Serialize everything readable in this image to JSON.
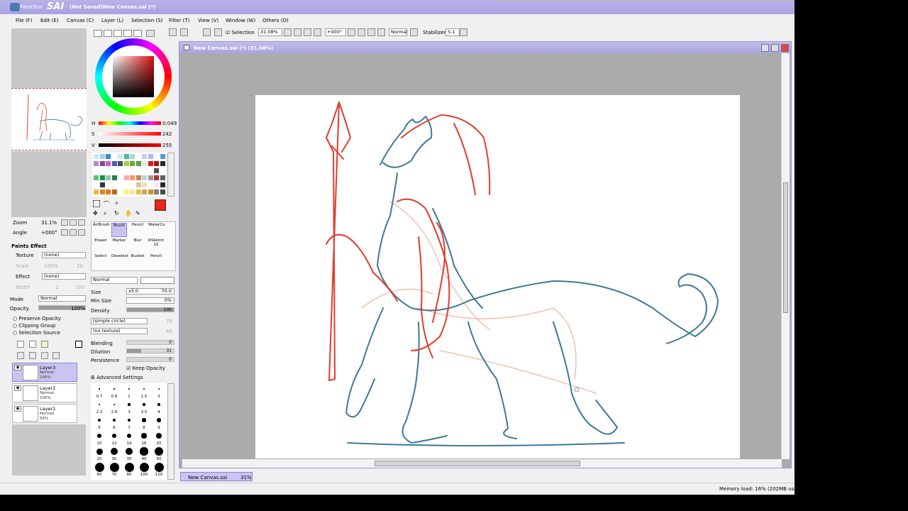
{
  "app": {
    "brand_small": "PaintTool",
    "brand_big": "SAI",
    "title": "(Not Saved)New Canvas.sai (*)"
  },
  "menu": [
    {
      "label": "File (F)"
    },
    {
      "label": "Edit (E)"
    },
    {
      "label": "Canvas (C)"
    },
    {
      "label": "Layer (L)"
    },
    {
      "label": "Selection (S)"
    },
    {
      "label": "Filter (T)"
    },
    {
      "label": "View (V)"
    },
    {
      "label": "Window (W)"
    },
    {
      "label": "Others (O)"
    }
  ],
  "navigator": {
    "zoom_label": "Zoom",
    "zoom_value": "31.1%",
    "angle_label": "Angle",
    "angle_value": "+000°"
  },
  "paints_effect": {
    "header": "Paints Effect",
    "texture_label": "Texture",
    "texture_value": "(none)",
    "scale_label": "Scale",
    "scale_value": "100%",
    "scale_num": "20",
    "effect_label": "Effect",
    "effect_value": "(none)",
    "width_label": "Width",
    "width_value": "1",
    "width_num": "100"
  },
  "layer_props": {
    "mode_label": "Mode",
    "mode_value": "Normal",
    "opacity_label": "Opacity",
    "opacity_value": "100%",
    "opacity_fraction": 1.0,
    "preserve_opacity": "Preserve Opacity",
    "clipping_group": "Clipping Group",
    "selection_source": "Selection Source"
  },
  "layers": [
    {
      "name": "Layer3",
      "mode": "Normal",
      "opacity": "100%",
      "selected": true
    },
    {
      "name": "Layer2",
      "mode": "Normal",
      "opacity": "100%",
      "selected": false
    },
    {
      "name": "Layer1",
      "mode": "Normal",
      "opacity": "54%",
      "selected": false
    }
  ],
  "color": {
    "h_label": "H",
    "h_value": "0:049",
    "s_label": "S",
    "s_value": "242",
    "v_label": "V",
    "v_value": "255",
    "primary": "#ee2211",
    "secondary": "#cfe3f5"
  },
  "swatches": [
    "#c8e8f8",
    "#9cd0f0",
    "#3890c8",
    "#fff",
    "#c8f0e8",
    "#48b8a0",
    "#a8d8d0",
    "#fff",
    "#d0c8f0",
    "#a8b8f0",
    "#fff",
    "#48a0d8",
    "#b088c8",
    "#7848a0",
    "#d058c8",
    "#4860a8",
    "#484868",
    "#a0d048",
    "#68b028",
    "#58a040",
    "#e8e8e8",
    "#d82020",
    "#a01818",
    "#282828",
    "#fff",
    "#fff",
    "#fff",
    "#fff",
    "#fff",
    "#fff",
    "#fff",
    "#fff",
    "#fff",
    "#fff",
    "#505050",
    "#fff",
    "#58c870",
    "#189048",
    "#90c8a8",
    "#288048",
    "#fff",
    "#f8a8a8",
    "#f89868",
    "#c88848",
    "#b8d0e8",
    "#a09888",
    "#b83030",
    "#606060",
    "#fff",
    "#383048",
    "#fff",
    "#fff",
    "#fff",
    "#fff",
    "#fff",
    "#d8c8a8",
    "#e8e0c0",
    "#fff",
    "#f8e8f0",
    "#282838",
    "#f0b848",
    "#d88828",
    "#e87818",
    "#b86820",
    "#fff",
    "#f8f070",
    "#f8e8a8",
    "#e0c050",
    "#c8a858",
    "#d09030",
    "#808080",
    "#484848"
  ],
  "tools": [
    {
      "label": "AirBrush"
    },
    {
      "label": "Brush"
    },
    {
      "label": "Pencil"
    },
    {
      "label": "WaterCo"
    },
    {
      "label": "Eraser"
    },
    {
      "label": "Marker"
    },
    {
      "label": "Blur"
    },
    {
      "label": "RSketch"
    },
    {
      "label": "Select"
    },
    {
      "label": "Deselect"
    },
    {
      "label": "Bucket"
    },
    {
      "label": "Pencil"
    }
  ],
  "brush": {
    "mode": "Normal",
    "size_label": "Size",
    "size_mult": "x5.0",
    "size_value": "70.0",
    "minsize_label": "Min Size",
    "minsize_value": "0%",
    "density_label": "Density",
    "density_value": "100",
    "shape_value": "(simple circle)",
    "shape_num": "79",
    "texture_value": "(no texture)",
    "texture_num": "68",
    "blending_label": "Blending",
    "blending_value": "0",
    "dilution_label": "Dilution",
    "dilution_value": "31",
    "persistence_label": "Persistence",
    "persistence_value": "0",
    "keep_opacity": "Keep Opacity",
    "advanced": "Advanced Settings",
    "rsketch_num": "10"
  },
  "brush_sizes": [
    [
      "0.7",
      "0.8",
      "1",
      "1.5",
      "2"
    ],
    [
      "2.3",
      "2.6",
      "3",
      "3.5",
      "4"
    ],
    [
      "5",
      "6",
      "7",
      "8",
      "9"
    ],
    [
      "10",
      "12",
      "14",
      "16",
      "20"
    ],
    [
      "25",
      "30",
      "35",
      "40",
      "50"
    ],
    [
      "60",
      "70",
      "80",
      "100",
      "120"
    ]
  ],
  "toolbar": {
    "selection_label": "Selection",
    "zoom_value": "31.08%",
    "angle_value": "+000°",
    "blend_value": "Normal",
    "stabilizer_label": "Stabilizer",
    "stabilizer_value": "S-1"
  },
  "canvas": {
    "title": "New Canvas.sai (*) (31.08%)"
  },
  "doc_tab": {
    "name": "New Canvas.sai",
    "zoom": "31%"
  },
  "status": {
    "memory": "Memory load: 16% (202MB used"
  }
}
